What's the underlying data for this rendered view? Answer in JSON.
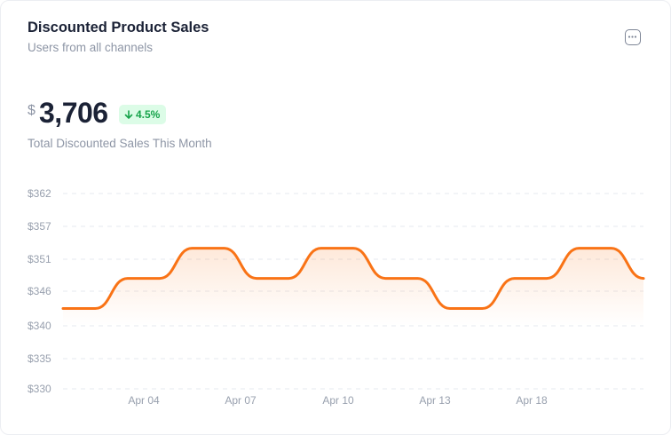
{
  "card": {
    "title": "Discounted Product Sales",
    "subtitle": "Users from all channels",
    "menu_icon": "more-horizontal-icon"
  },
  "summary": {
    "currency_symbol": "$",
    "total": "3,706",
    "change": "4.5%",
    "change_icon": "arrow-down-icon",
    "change_color": "#16a34a",
    "caption": "Total Discounted Sales This Month"
  },
  "chart_data": {
    "type": "area",
    "title": "",
    "xlabel": "",
    "ylabel": "",
    "y_ticks": [
      330,
      335,
      340,
      346,
      351,
      357,
      362
    ],
    "y_tick_labels": [
      "$330",
      "$335",
      "$340",
      "$346",
      "$351",
      "$357",
      "$362"
    ],
    "ylim": [
      330,
      362
    ],
    "x_tick_labels": [
      "Apr 04",
      "Apr 07",
      "Apr 10",
      "Apr 13",
      "Apr 18"
    ],
    "grid": true,
    "line_color": "#f97316",
    "series": [
      {
        "name": "",
        "values": [
          343,
          343,
          348,
          348,
          353,
          353,
          348,
          348,
          353,
          353,
          348,
          348,
          343,
          343,
          348,
          348,
          353,
          353,
          348
        ]
      }
    ]
  }
}
